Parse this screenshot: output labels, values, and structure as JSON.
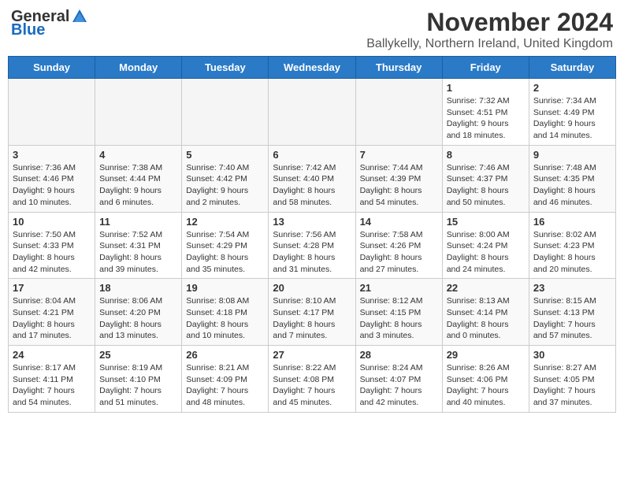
{
  "logo": {
    "general": "General",
    "blue": "Blue"
  },
  "title": "November 2024",
  "location": "Ballykelly, Northern Ireland, United Kingdom",
  "weekdays": [
    "Sunday",
    "Monday",
    "Tuesday",
    "Wednesday",
    "Thursday",
    "Friday",
    "Saturday"
  ],
  "weeks": [
    [
      {
        "day": "",
        "info": ""
      },
      {
        "day": "",
        "info": ""
      },
      {
        "day": "",
        "info": ""
      },
      {
        "day": "",
        "info": ""
      },
      {
        "day": "",
        "info": ""
      },
      {
        "day": "1",
        "info": "Sunrise: 7:32 AM\nSunset: 4:51 PM\nDaylight: 9 hours and 18 minutes."
      },
      {
        "day": "2",
        "info": "Sunrise: 7:34 AM\nSunset: 4:49 PM\nDaylight: 9 hours and 14 minutes."
      }
    ],
    [
      {
        "day": "3",
        "info": "Sunrise: 7:36 AM\nSunset: 4:46 PM\nDaylight: 9 hours and 10 minutes."
      },
      {
        "day": "4",
        "info": "Sunrise: 7:38 AM\nSunset: 4:44 PM\nDaylight: 9 hours and 6 minutes."
      },
      {
        "day": "5",
        "info": "Sunrise: 7:40 AM\nSunset: 4:42 PM\nDaylight: 9 hours and 2 minutes."
      },
      {
        "day": "6",
        "info": "Sunrise: 7:42 AM\nSunset: 4:40 PM\nDaylight: 8 hours and 58 minutes."
      },
      {
        "day": "7",
        "info": "Sunrise: 7:44 AM\nSunset: 4:39 PM\nDaylight: 8 hours and 54 minutes."
      },
      {
        "day": "8",
        "info": "Sunrise: 7:46 AM\nSunset: 4:37 PM\nDaylight: 8 hours and 50 minutes."
      },
      {
        "day": "9",
        "info": "Sunrise: 7:48 AM\nSunset: 4:35 PM\nDaylight: 8 hours and 46 minutes."
      }
    ],
    [
      {
        "day": "10",
        "info": "Sunrise: 7:50 AM\nSunset: 4:33 PM\nDaylight: 8 hours and 42 minutes."
      },
      {
        "day": "11",
        "info": "Sunrise: 7:52 AM\nSunset: 4:31 PM\nDaylight: 8 hours and 39 minutes."
      },
      {
        "day": "12",
        "info": "Sunrise: 7:54 AM\nSunset: 4:29 PM\nDaylight: 8 hours and 35 minutes."
      },
      {
        "day": "13",
        "info": "Sunrise: 7:56 AM\nSunset: 4:28 PM\nDaylight: 8 hours and 31 minutes."
      },
      {
        "day": "14",
        "info": "Sunrise: 7:58 AM\nSunset: 4:26 PM\nDaylight: 8 hours and 27 minutes."
      },
      {
        "day": "15",
        "info": "Sunrise: 8:00 AM\nSunset: 4:24 PM\nDaylight: 8 hours and 24 minutes."
      },
      {
        "day": "16",
        "info": "Sunrise: 8:02 AM\nSunset: 4:23 PM\nDaylight: 8 hours and 20 minutes."
      }
    ],
    [
      {
        "day": "17",
        "info": "Sunrise: 8:04 AM\nSunset: 4:21 PM\nDaylight: 8 hours and 17 minutes."
      },
      {
        "day": "18",
        "info": "Sunrise: 8:06 AM\nSunset: 4:20 PM\nDaylight: 8 hours and 13 minutes."
      },
      {
        "day": "19",
        "info": "Sunrise: 8:08 AM\nSunset: 4:18 PM\nDaylight: 8 hours and 10 minutes."
      },
      {
        "day": "20",
        "info": "Sunrise: 8:10 AM\nSunset: 4:17 PM\nDaylight: 8 hours and 7 minutes."
      },
      {
        "day": "21",
        "info": "Sunrise: 8:12 AM\nSunset: 4:15 PM\nDaylight: 8 hours and 3 minutes."
      },
      {
        "day": "22",
        "info": "Sunrise: 8:13 AM\nSunset: 4:14 PM\nDaylight: 8 hours and 0 minutes."
      },
      {
        "day": "23",
        "info": "Sunrise: 8:15 AM\nSunset: 4:13 PM\nDaylight: 7 hours and 57 minutes."
      }
    ],
    [
      {
        "day": "24",
        "info": "Sunrise: 8:17 AM\nSunset: 4:11 PM\nDaylight: 7 hours and 54 minutes."
      },
      {
        "day": "25",
        "info": "Sunrise: 8:19 AM\nSunset: 4:10 PM\nDaylight: 7 hours and 51 minutes."
      },
      {
        "day": "26",
        "info": "Sunrise: 8:21 AM\nSunset: 4:09 PM\nDaylight: 7 hours and 48 minutes."
      },
      {
        "day": "27",
        "info": "Sunrise: 8:22 AM\nSunset: 4:08 PM\nDaylight: 7 hours and 45 minutes."
      },
      {
        "day": "28",
        "info": "Sunrise: 8:24 AM\nSunset: 4:07 PM\nDaylight: 7 hours and 42 minutes."
      },
      {
        "day": "29",
        "info": "Sunrise: 8:26 AM\nSunset: 4:06 PM\nDaylight: 7 hours and 40 minutes."
      },
      {
        "day": "30",
        "info": "Sunrise: 8:27 AM\nSunset: 4:05 PM\nDaylight: 7 hours and 37 minutes."
      }
    ]
  ]
}
